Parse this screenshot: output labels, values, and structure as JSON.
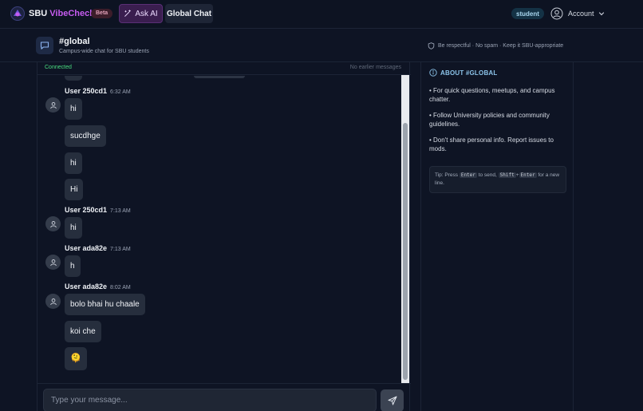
{
  "topbar": {
    "brand_main": "SBU ",
    "brand_accent": "VibeCheck",
    "beta": "Beta",
    "ask_ai": "Ask AI",
    "global_chat": "Global Chat",
    "role": "student",
    "account": "Account"
  },
  "channel": {
    "title": "#global",
    "subtitle": "Campus-wide chat for SBU students",
    "rules": "Be respectful · No spam · Keep it SBU-appropriate"
  },
  "chat": {
    "status": "Connected",
    "no_earlier": "No earlier messages",
    "groups": [
      {
        "user": "User 250cd1",
        "time": "6:32 AM",
        "messages": [
          "hi",
          "sucdhge",
          "hi",
          "Hi"
        ]
      },
      {
        "user": "User 250cd1",
        "time": "7:13 AM",
        "messages": [
          "hi"
        ]
      },
      {
        "user": "User ada82e",
        "time": "7:13 AM",
        "messages": [
          "h"
        ]
      },
      {
        "user": "User ada82e",
        "time": "8:02 AM",
        "messages": [
          "bolo bhai hu chaale",
          "koi che",
          "🫠"
        ]
      }
    ],
    "input_placeholder": "Type your message..."
  },
  "about": {
    "title": "ABOUT #GLOBAL",
    "items": [
      "• For quick questions, meetups, and campus chatter.",
      "• Follow University policies and community guidelines.",
      "• Don't share personal info. Report issues to mods."
    ],
    "tip": {
      "prefix": "Tip: Press ",
      "key1": "Enter",
      "mid": " to send, ",
      "key2": "Shift",
      "plus": "+",
      "key3": "Enter",
      "suffix": " for a new line."
    }
  },
  "colors": {
    "background": "#0e1424",
    "accent": "#c65cf0",
    "connected": "#4ade80",
    "about_title": "#8cc4ea"
  }
}
